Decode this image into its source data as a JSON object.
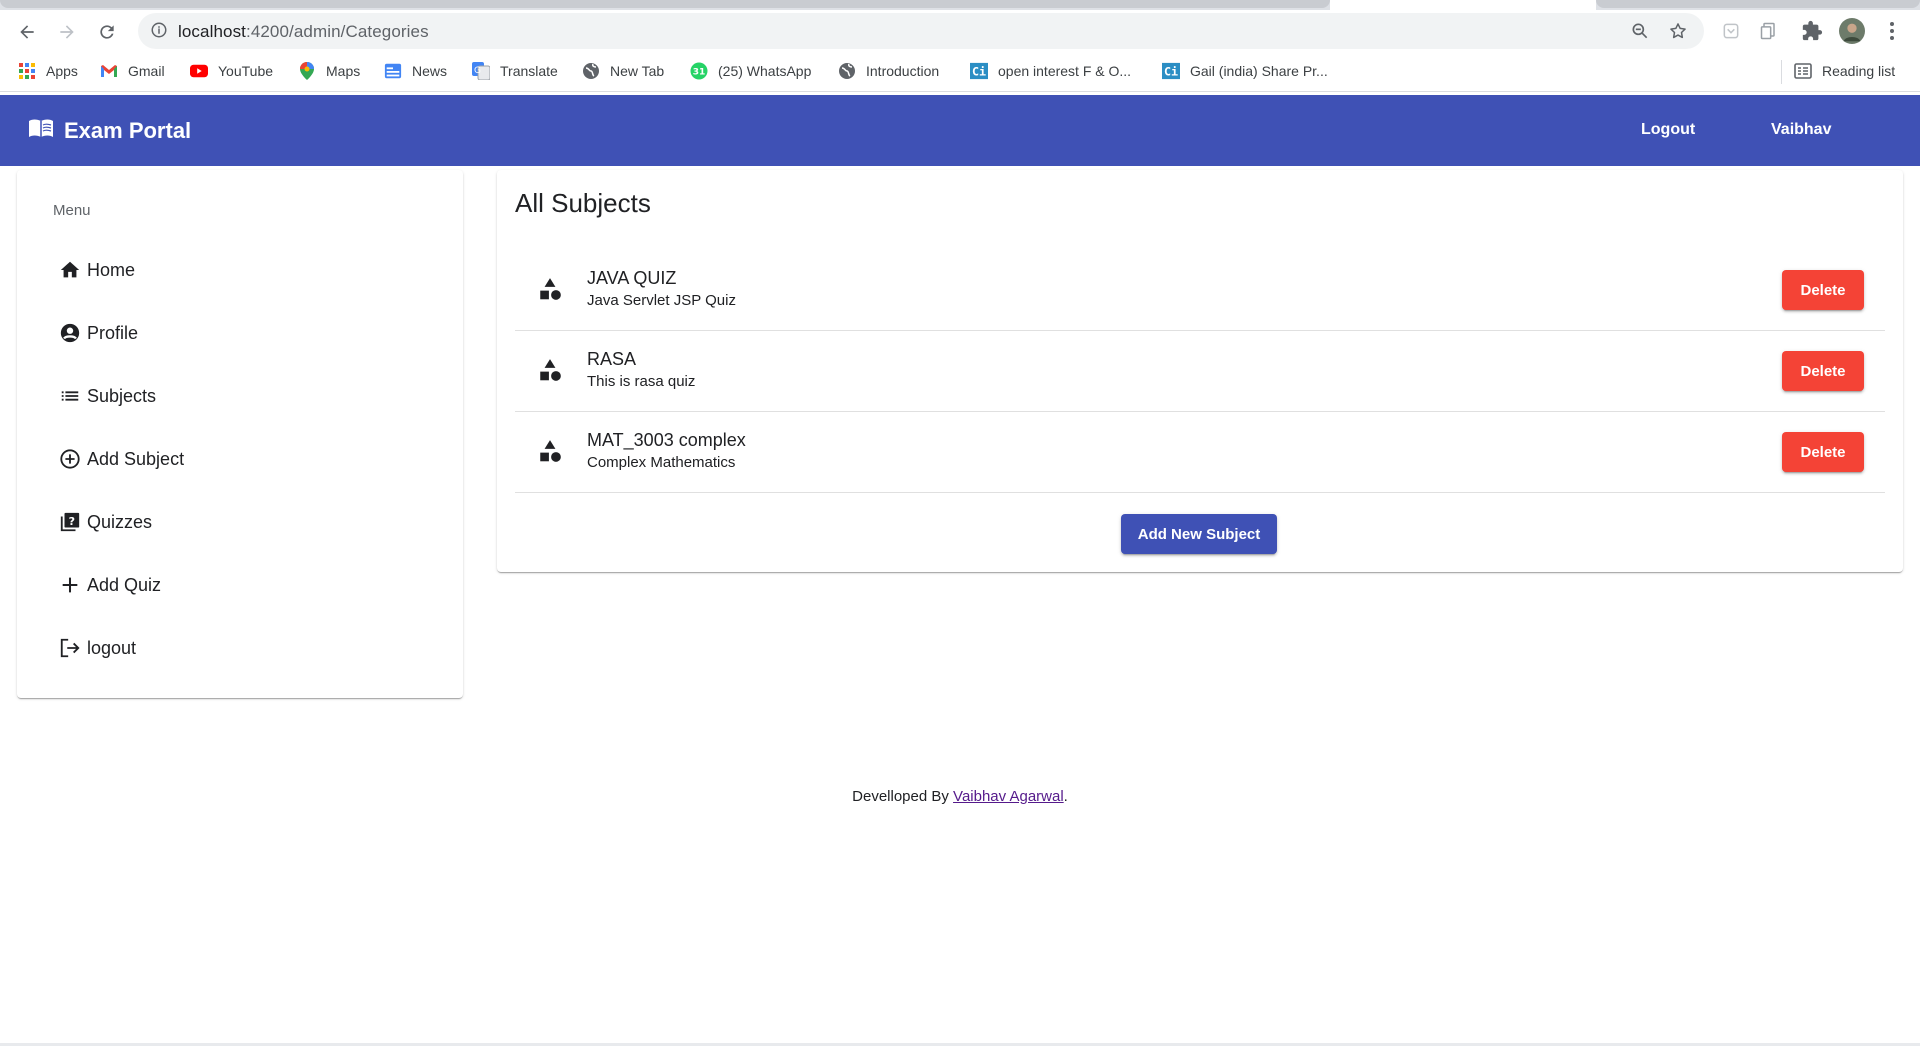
{
  "browser": {
    "url_host": "localhost",
    "url_path": ":4200/admin/Categories",
    "bookmarks": [
      {
        "label": "Apps",
        "icon": "apps-grid-icon"
      },
      {
        "label": "Gmail",
        "icon": "gmail-icon"
      },
      {
        "label": "YouTube",
        "icon": "youtube-icon"
      },
      {
        "label": "Maps",
        "icon": "maps-pin-icon"
      },
      {
        "label": "News",
        "icon": "news-icon"
      },
      {
        "label": "Translate",
        "icon": "translate-icon"
      },
      {
        "label": "New Tab",
        "icon": "globe-icon"
      },
      {
        "label": "(25) WhatsApp",
        "icon": "whatsapp-badge-icon"
      },
      {
        "label": "Introduction",
        "icon": "globe-icon"
      },
      {
        "label": "open interest F & O...",
        "icon": "ci-icon"
      },
      {
        "label": "Gail (india) Share Pr...",
        "icon": "ci-icon"
      }
    ],
    "whatsapp_badge": "31",
    "ci_text": "Ci",
    "reading_list": "Reading list"
  },
  "header": {
    "brand": "Exam Portal",
    "logout": "Logout",
    "user": "Vaibhav"
  },
  "sidebar": {
    "title": "Menu",
    "items": [
      {
        "label": "Home",
        "icon": "home-icon"
      },
      {
        "label": "Profile",
        "icon": "account-circle-icon"
      },
      {
        "label": "Subjects",
        "icon": "list-icon"
      },
      {
        "label": "Add Subject",
        "icon": "add-circle-icon"
      },
      {
        "label": "Quizzes",
        "icon": "quiz-icon"
      },
      {
        "label": "Add Quiz",
        "icon": "plus-icon"
      },
      {
        "label": "logout",
        "icon": "logout-icon"
      }
    ]
  },
  "main": {
    "title": "All Subjects",
    "subjects": [
      {
        "title": "JAVA QUIZ",
        "description": "Java Servlet JSP Quiz"
      },
      {
        "title": "RASA",
        "description": "This is rasa quiz"
      },
      {
        "title": "MAT_3003 complex",
        "description": "Complex Mathematics"
      }
    ],
    "delete_label": "Delete",
    "add_label": "Add New Subject"
  },
  "footer": {
    "prefix": "Develloped By ",
    "author": "Vaibhav Agarwal",
    "suffix": "."
  },
  "colors": {
    "primary": "#3f51b5",
    "warn": "#f44336"
  }
}
